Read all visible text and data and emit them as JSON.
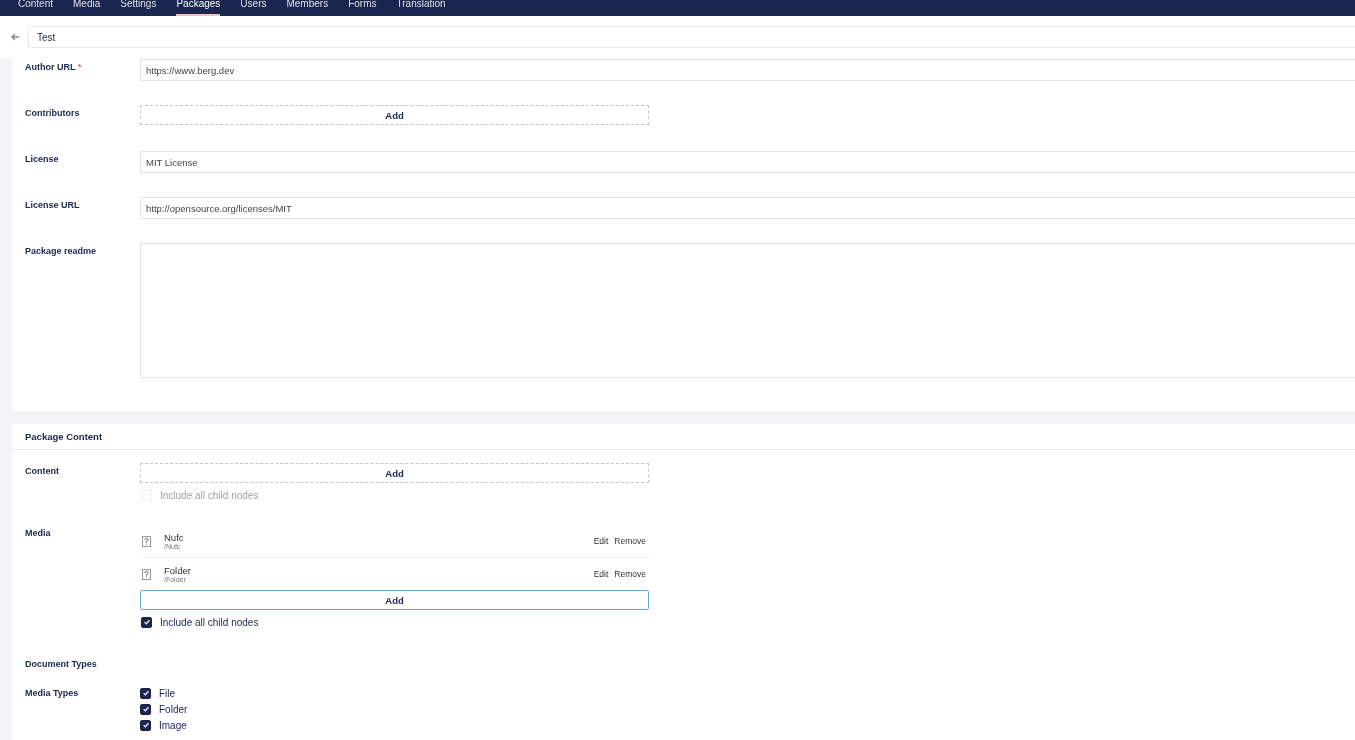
{
  "nav": [
    {
      "label": "Content",
      "selected": false
    },
    {
      "label": "Media",
      "selected": false
    },
    {
      "label": "Settings",
      "selected": false
    },
    {
      "label": "Packages",
      "selected": true
    },
    {
      "label": "Users",
      "selected": false
    },
    {
      "label": "Members",
      "selected": false
    },
    {
      "label": "Forms",
      "selected": false
    },
    {
      "label": "Translation",
      "selected": false
    }
  ],
  "header": {
    "title": "Test"
  },
  "info_fields": [
    {
      "kind": "text",
      "label": "Author URL",
      "required_mark": "*",
      "value": "https://www.berg.dev"
    },
    {
      "kind": "picker",
      "label": "Contributors",
      "button": "Add"
    },
    {
      "kind": "text",
      "label": "License",
      "value": "MIT License"
    },
    {
      "kind": "text",
      "label": "License URL",
      "value": "http://opensource.org/licenses/MIT"
    },
    {
      "kind": "textarea",
      "label": "Package readme"
    }
  ],
  "package_content": {
    "title": "Package Content",
    "rows": [
      {
        "kind": "picker",
        "label": "Content",
        "items": [],
        "button": "Add",
        "focused": false,
        "include_children": {
          "label": "Include all child nodes",
          "checked": false,
          "disabled": true
        }
      },
      {
        "kind": "picker",
        "label": "Media",
        "items": [
          {
            "name": "Nufc",
            "path": "/Nufc",
            "edit": "Edit",
            "remove": "Remove"
          },
          {
            "name": "Folder",
            "path": "/Folder",
            "edit": "Edit",
            "remove": "Remove"
          }
        ],
        "button": "Add",
        "focused": true,
        "include_children": {
          "label": "Include all child nodes",
          "checked": true,
          "disabled": false
        }
      },
      {
        "kind": "heading",
        "label": "Document Types"
      },
      {
        "kind": "checklist",
        "label": "Media Types",
        "options": [
          {
            "label": "File",
            "checked": true
          },
          {
            "label": "Folder",
            "checked": true
          },
          {
            "label": "Image",
            "checked": true
          }
        ]
      }
    ]
  }
}
